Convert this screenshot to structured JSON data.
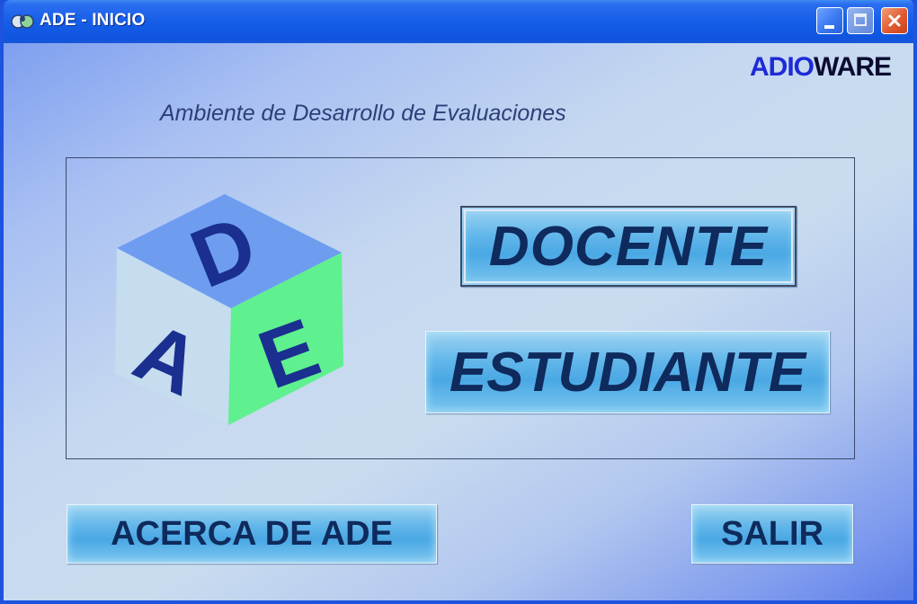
{
  "window": {
    "title": "ADE - INICIO",
    "app_icon": "ade-app-icon",
    "controls": {
      "minimize_icon": "minimize-icon",
      "maximize_icon": "maximize-icon",
      "close_icon": "close-icon"
    }
  },
  "brand": {
    "logo_part1": "ADIO",
    "logo_part2": "WARE"
  },
  "main": {
    "subtitle": "Ambiente de Desarrollo de Evaluaciones",
    "cube_letters": {
      "top": "D",
      "left": "A",
      "right": "E"
    },
    "docente_label": "DOCENTE",
    "estudiante_label": "ESTUDIANTE"
  },
  "footer": {
    "about_label": "ACERCA DE ADE",
    "exit_label": "SALIR"
  },
  "colors": {
    "titlebar": "#165ee8",
    "button_fill": "#4aa8e4",
    "button_text": "#0f2a5c",
    "cube_top": "#6e9df0",
    "cube_left": "#c6dcef",
    "cube_right": "#5ff08f",
    "cube_letter": "#1a2f8f",
    "logo_blue": "#1d2bd6"
  }
}
